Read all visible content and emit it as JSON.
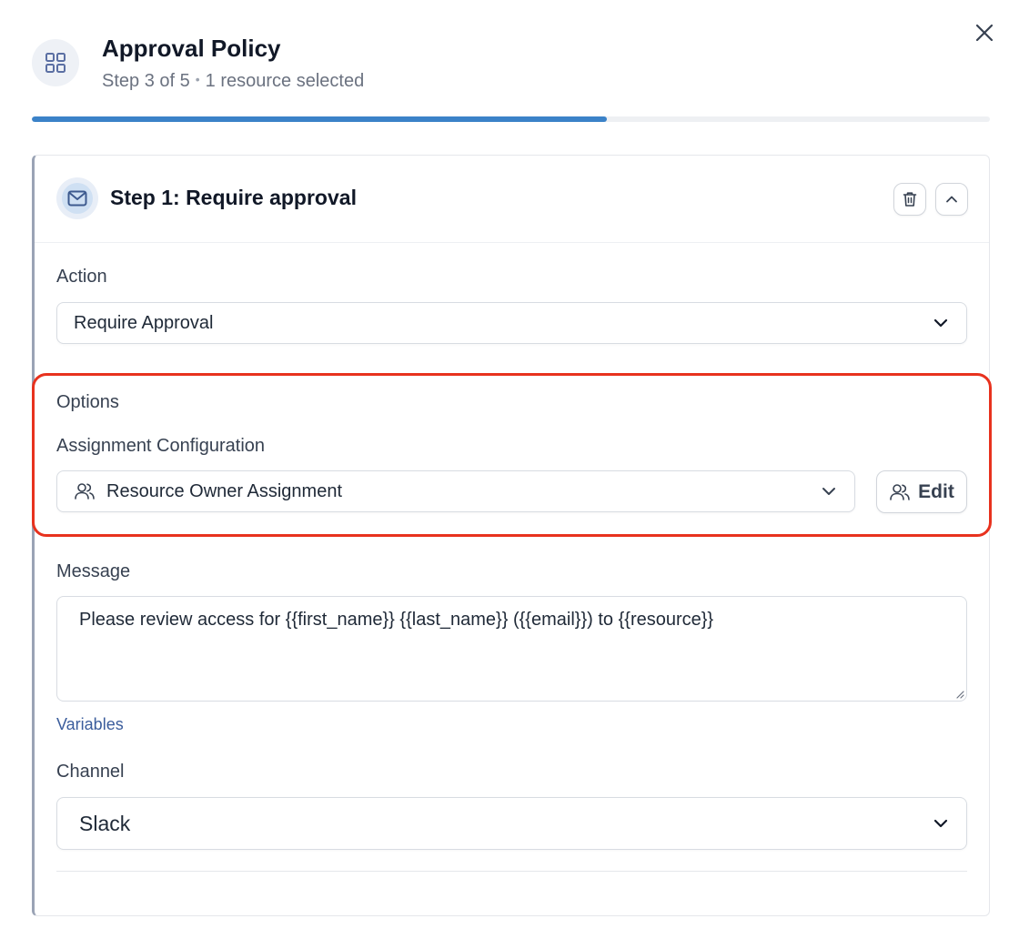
{
  "header": {
    "title": "Approval Policy",
    "step_text": "Step 3 of 5",
    "separator": "•",
    "resource_text": "1 resource selected",
    "progress": 0.6
  },
  "step_card": {
    "title": "Step 1: Require approval",
    "icon": "mail-icon"
  },
  "action": {
    "label": "Action",
    "value": "Require Approval"
  },
  "options": {
    "label": "Options",
    "assignment_label": "Assignment Configuration",
    "assignment_value": "Resource Owner Assignment",
    "edit_label": "Edit"
  },
  "message": {
    "label": "Message",
    "value": "Please review access for {{first_name}} {{last_name}} ({{email}}) to {{resource}}",
    "variables_link": "Variables"
  },
  "channel": {
    "label": "Channel",
    "value": "Slack"
  },
  "colors": {
    "progress": "#3b82c8",
    "highlight": "#e8321e",
    "link": "#3b5d9c"
  }
}
